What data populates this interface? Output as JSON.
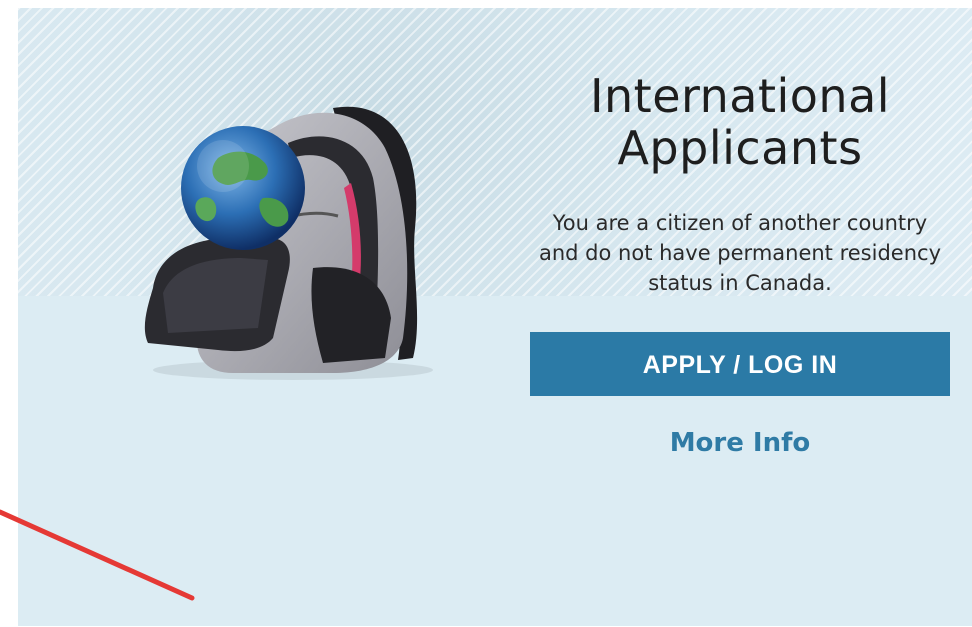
{
  "title": "International Applicants",
  "description": "You are a citizen of another country and do not have permanent residency status in Canada.",
  "apply_button": "APPLY / LOG IN",
  "more_info_link": "More Info",
  "colors": {
    "accent": "#2b7aa6",
    "link": "#2f7ba5",
    "annotation": "#e53935"
  },
  "icons": {
    "illustration": "backpack-with-globe-icon"
  }
}
